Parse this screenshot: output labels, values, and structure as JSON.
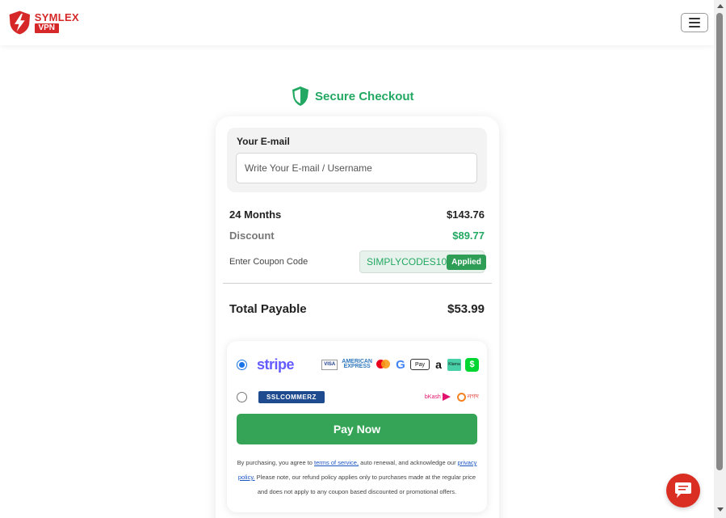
{
  "header": {
    "logo_word": "SYMLEX",
    "logo_vpn": "VPN",
    "logo_icon": "shield-bolt-icon",
    "menu_icon": "hamburger-icon"
  },
  "checkout": {
    "title": "Secure Checkout",
    "title_icon": "shield-icon",
    "accent_color": "#22a862"
  },
  "email": {
    "label": "Your E-mail",
    "placeholder": "Write Your E-mail / Username",
    "value": ""
  },
  "summary": {
    "plan_label": "24 Months",
    "plan_price": "$143.76",
    "discount_label": "Discount",
    "discount_value": "$89.77",
    "coupon_label": "Enter Coupon Code",
    "coupon_code": "SIMPLYCODES10",
    "coupon_status": "Applied",
    "total_label": "Total Payable",
    "total_value": "$53.99"
  },
  "payment": {
    "methods": [
      {
        "name": "stripe",
        "selected": true,
        "icons": [
          "visa-icon",
          "american-express-icon",
          "mastercard-icon",
          "google-pay-icon",
          "apple-pay-icon",
          "amazon-icon",
          "klarna-icon",
          "cash-app-icon"
        ]
      },
      {
        "name": "sslcommerz",
        "selected": false,
        "icons": [
          "bkash-icon",
          "nagad-icon"
        ]
      }
    ],
    "stripe_label": "stripe",
    "ssl_label": "SSLCOMMERZ",
    "visa_text": "VISA",
    "amex_line1": "AMERICAN",
    "amex_line2": "EXPRESS",
    "apple_text": "Pay",
    "amazon_text": "a",
    "klarna_text": "Klarna",
    "cash_text": "$",
    "bkash_text": "bKash",
    "nagad_text": "নগদ",
    "pay_button": "Pay Now",
    "button_color": "#36a456"
  },
  "terms": {
    "prefix": "By purchasing, you agree to ",
    "terms_link": "terms of service,",
    "middle": " auto renewal, and acknowledge our ",
    "privacy_link": "privacy policy.",
    "suffix": " Please note, our refund policy applies only to purchases made at the regular price and does not apply to any coupon based discounted or promotional offers."
  },
  "chat": {
    "icon": "chat-icon",
    "color": "#d92e21"
  }
}
